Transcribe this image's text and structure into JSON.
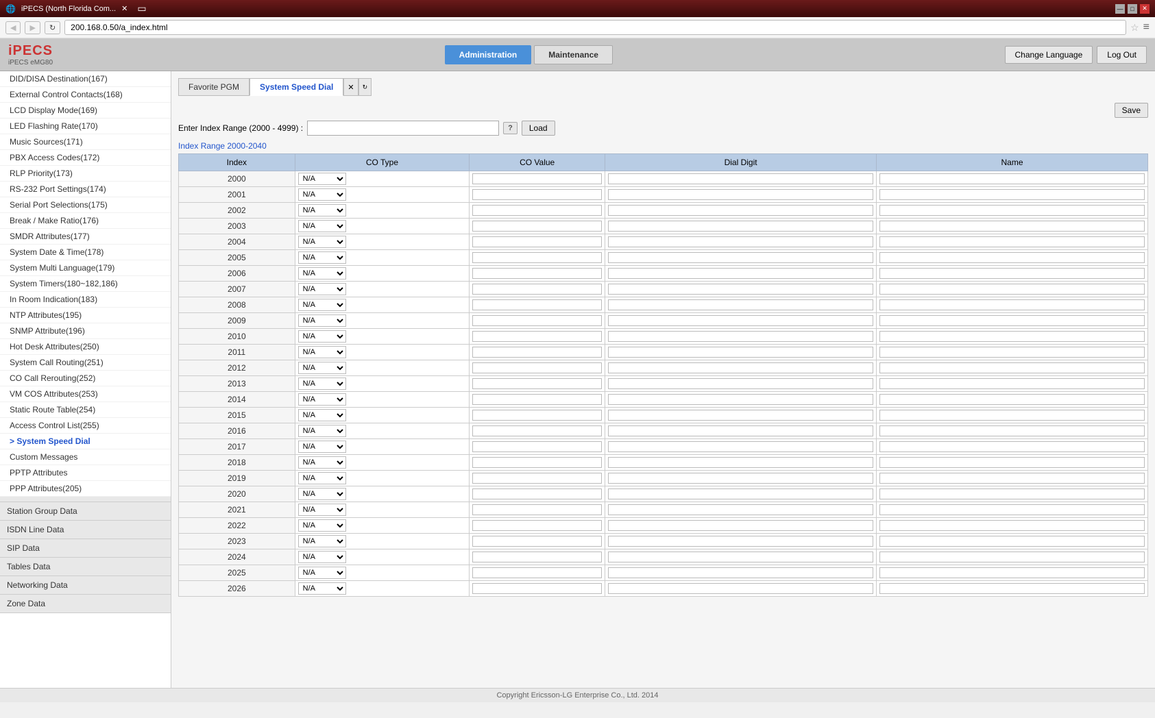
{
  "browser": {
    "tab_title": "iPECS (North Florida Com...",
    "url": "200.168.0.50/a_index.html",
    "new_tab_label": "+"
  },
  "header": {
    "logo": "iPECS",
    "logo_sub": "iPECS eMG80",
    "tabs": [
      {
        "id": "administration",
        "label": "Administration",
        "active": true
      },
      {
        "id": "maintenance",
        "label": "Maintenance",
        "active": false
      }
    ],
    "change_language_label": "Change Language",
    "log_out_label": "Log Out"
  },
  "sidebar": {
    "items": [
      {
        "id": "did-disa",
        "label": "DID/DISA Destination(167)",
        "active": false
      },
      {
        "id": "external-control",
        "label": "External Control Contacts(168)",
        "active": false
      },
      {
        "id": "lcd-display",
        "label": "LCD Display Mode(169)",
        "active": false
      },
      {
        "id": "led-flashing",
        "label": "LED Flashing Rate(170)",
        "active": false
      },
      {
        "id": "music-sources",
        "label": "Music Sources(171)",
        "active": false
      },
      {
        "id": "pbx-access",
        "label": "PBX Access Codes(172)",
        "active": false
      },
      {
        "id": "rlp-priority",
        "label": "RLP Priority(173)",
        "active": false
      },
      {
        "id": "rs232",
        "label": "RS-232 Port Settings(174)",
        "active": false
      },
      {
        "id": "serial-port",
        "label": "Serial Port Selections(175)",
        "active": false
      },
      {
        "id": "break-make",
        "label": "Break / Make Ratio(176)",
        "active": false
      },
      {
        "id": "smdr",
        "label": "SMDR Attributes(177)",
        "active": false
      },
      {
        "id": "system-date",
        "label": "System Date & Time(178)",
        "active": false
      },
      {
        "id": "system-multi",
        "label": "System Multi Language(179)",
        "active": false
      },
      {
        "id": "system-timers",
        "label": "System Timers(180~182,186)",
        "active": false
      },
      {
        "id": "in-room",
        "label": "In Room Indication(183)",
        "active": false
      },
      {
        "id": "ntp",
        "label": "NTP Attributes(195)",
        "active": false
      },
      {
        "id": "snmp",
        "label": "SNMP Attribute(196)",
        "active": false
      },
      {
        "id": "hot-desk",
        "label": "Hot Desk Attributes(250)",
        "active": false
      },
      {
        "id": "system-call",
        "label": "System Call Routing(251)",
        "active": false
      },
      {
        "id": "co-call",
        "label": "CO Call Rerouting(252)",
        "active": false
      },
      {
        "id": "vm-cos",
        "label": "VM COS Attributes(253)",
        "active": false
      },
      {
        "id": "static-route",
        "label": "Static Route Table(254)",
        "active": false
      },
      {
        "id": "access-control",
        "label": "Access Control List(255)",
        "active": false
      },
      {
        "id": "system-speed-dial",
        "label": "System Speed Dial",
        "active": true,
        "arrow": true
      },
      {
        "id": "custom-messages",
        "label": "Custom Messages",
        "active": false
      },
      {
        "id": "pptp",
        "label": "PPTP Attributes",
        "active": false
      },
      {
        "id": "ppp",
        "label": "PPP Attributes(205)",
        "active": false
      }
    ],
    "sections": [
      {
        "id": "station-group",
        "label": "Station Group Data"
      },
      {
        "id": "isdn-line",
        "label": "ISDN Line Data"
      },
      {
        "id": "sip-data",
        "label": "SIP Data"
      },
      {
        "id": "tables-data",
        "label": "Tables Data"
      },
      {
        "id": "networking",
        "label": "Networking Data"
      },
      {
        "id": "zone-data",
        "label": "Zone Data"
      }
    ]
  },
  "content": {
    "tabs": [
      {
        "id": "favorite-pgm",
        "label": "Favorite PGM",
        "active": false
      },
      {
        "id": "system-speed-dial",
        "label": "System Speed Dial",
        "active": true
      }
    ],
    "index_range_label": "Enter Index Range (2000 - 4999) :",
    "index_range_value": "",
    "load_btn": "Load",
    "save_btn": "Save",
    "index_range_display": "Index Range 2000-2040",
    "table_headers": {
      "index": "Index",
      "co_type": "CO Type",
      "co_value": "CO Value",
      "dial_digit": "Dial Digit",
      "name": "Name"
    },
    "co_type_options": [
      "N/A"
    ],
    "rows": [
      {
        "index": "2000"
      },
      {
        "index": "2001"
      },
      {
        "index": "2002"
      },
      {
        "index": "2003"
      },
      {
        "index": "2004"
      },
      {
        "index": "2005"
      },
      {
        "index": "2006"
      },
      {
        "index": "2007"
      },
      {
        "index": "2008"
      },
      {
        "index": "2009"
      },
      {
        "index": "2010"
      },
      {
        "index": "2011"
      },
      {
        "index": "2012"
      },
      {
        "index": "2013"
      },
      {
        "index": "2014"
      },
      {
        "index": "2015"
      },
      {
        "index": "2016"
      },
      {
        "index": "2017"
      },
      {
        "index": "2018"
      },
      {
        "index": "2019"
      },
      {
        "index": "2020"
      },
      {
        "index": "2021"
      },
      {
        "index": "2022"
      },
      {
        "index": "2023"
      },
      {
        "index": "2024"
      },
      {
        "index": "2025"
      },
      {
        "index": "2026"
      }
    ]
  },
  "footer": {
    "copyright": "Copyright Ericsson-LG Enterprise Co., Ltd. 2014"
  }
}
